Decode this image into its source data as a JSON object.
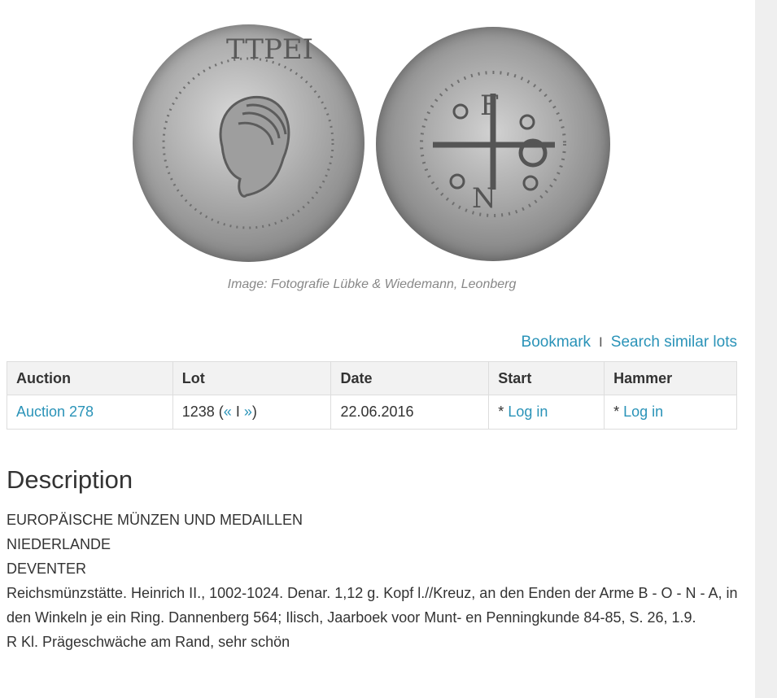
{
  "image": {
    "caption": "Image: Fotografie Lübke & Wiedemann, Leonberg",
    "obverse_legend": "TTPEI",
    "reverse_center": [
      "F",
      "N"
    ]
  },
  "actions": {
    "bookmark": "Bookmark",
    "separator": "I",
    "search_similar": "Search similar lots"
  },
  "table": {
    "headers": {
      "auction": "Auction",
      "lot": "Lot",
      "date": "Date",
      "start": "Start",
      "hammer": "Hammer"
    },
    "row": {
      "auction": "Auction 278",
      "lot_number": "1238",
      "lot_open": " (",
      "prev": "«",
      "lot_sep": " I ",
      "next": "»",
      "lot_close": ")",
      "date": "22.06.2016",
      "start_prefix": "* ",
      "start_link": "Log in",
      "hammer_prefix": "* ",
      "hammer_link": "Log in"
    }
  },
  "description": {
    "heading": "Description",
    "lines": [
      "EUROPÄISCHE MÜNZEN UND MEDAILLEN",
      "NIEDERLANDE",
      "DEVENTER",
      "Reichsmünzstätte. Heinrich II., 1002-1024. Denar. 1,12 g. Kopf l.//Kreuz, an den Enden der Arme B - O - N - A, in den Winkeln je ein Ring. Dannenberg 564; Ilisch, Jaarboek voor Munt- en Penningkunde 84-85, S. 26, 1.9.",
      "R Kl. Prägeschwäche am Rand, sehr schön"
    ]
  }
}
